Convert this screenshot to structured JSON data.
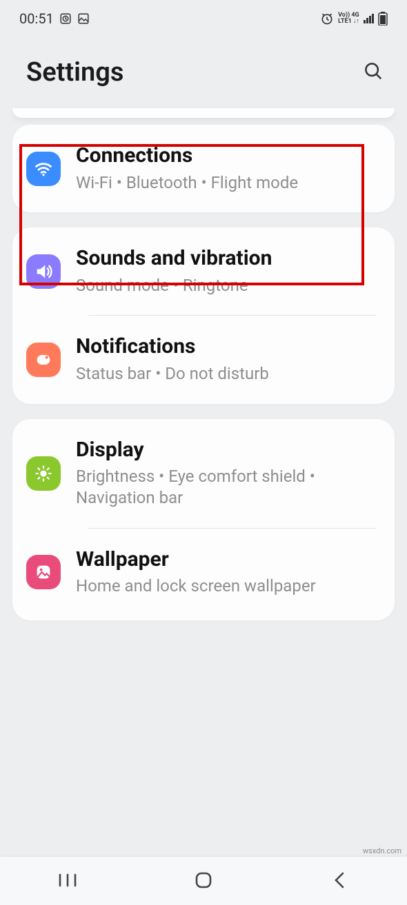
{
  "statusbar": {
    "time": "00:51",
    "net_top": "Vo))  4G",
    "net_bot": "LTE1 ↓↑"
  },
  "header": {
    "title": "Settings"
  },
  "groups": [
    {
      "items": [
        {
          "title": "Connections",
          "sub": "Wi‑Fi  •  Bluetooth  •  Flight mode"
        }
      ]
    },
    {
      "items": [
        {
          "title": "Sounds and vibration",
          "sub": "Sound mode  •  Ringtone"
        },
        {
          "title": "Notifications",
          "sub": "Status bar  •  Do not disturb"
        }
      ]
    },
    {
      "items": [
        {
          "title": "Display",
          "sub": "Brightness  •  Eye comfort shield  •  Navigation bar"
        },
        {
          "title": "Wallpaper",
          "sub": "Home and lock screen wallpaper"
        }
      ]
    }
  ],
  "watermark": "wsxdn.com"
}
